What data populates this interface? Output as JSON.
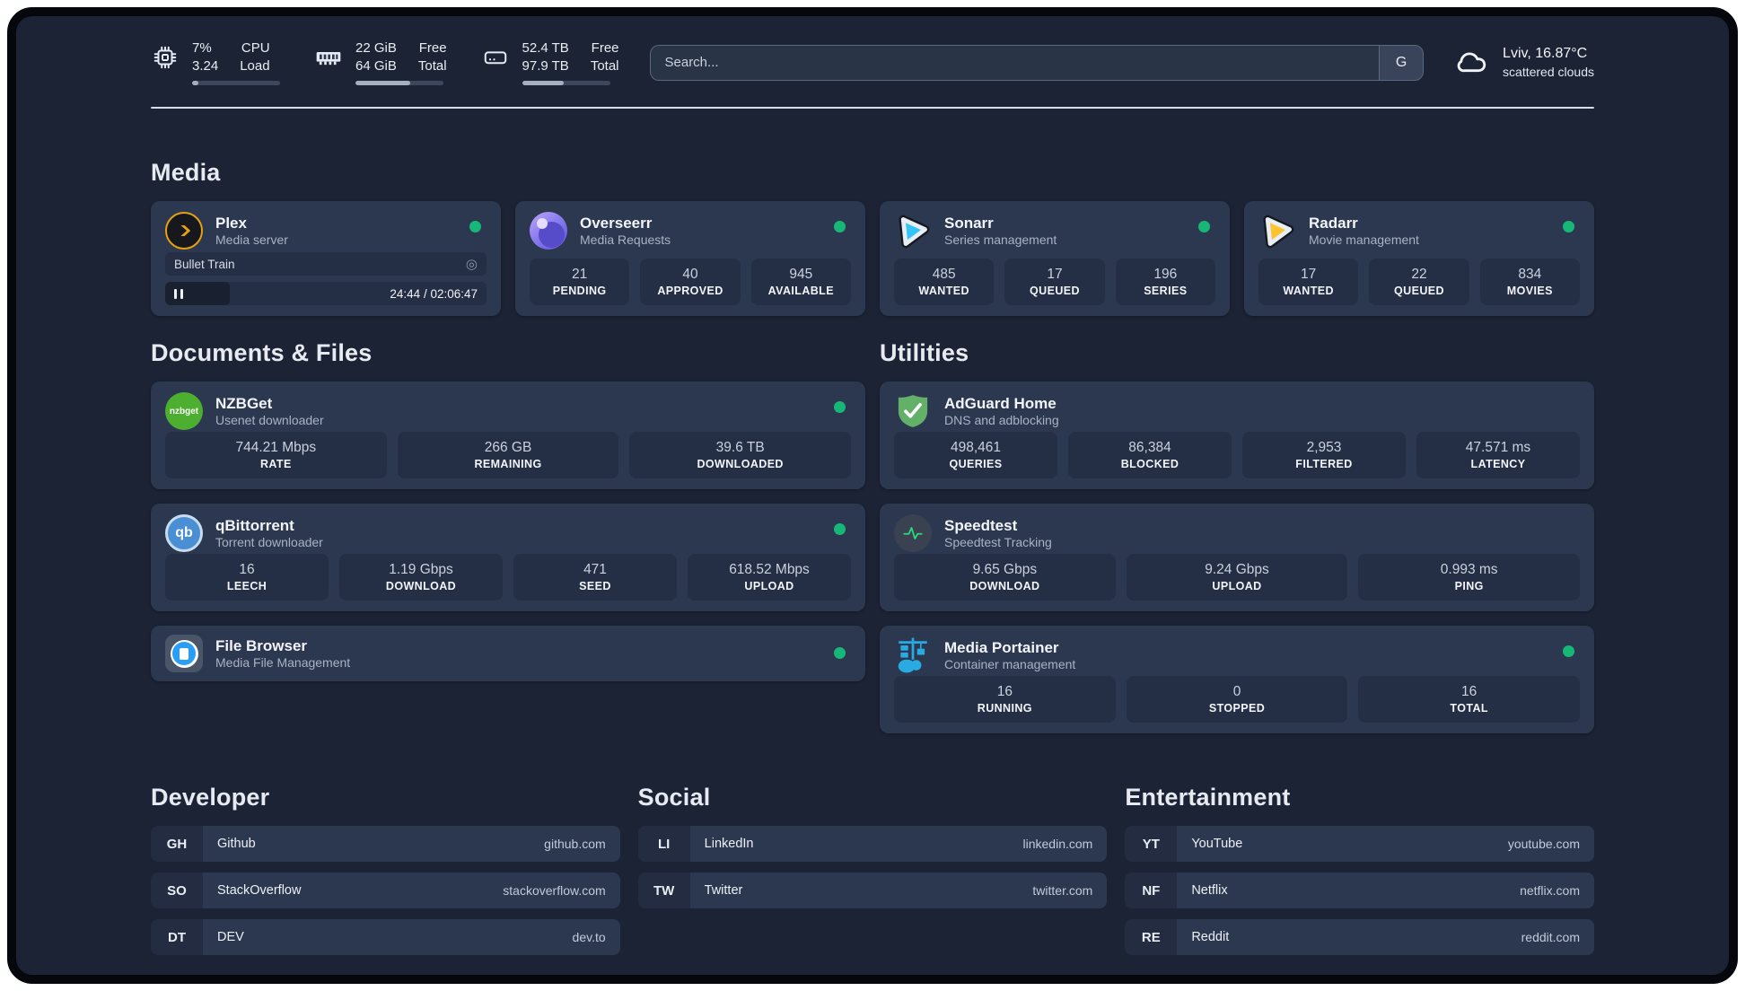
{
  "colors": {
    "page_bg": "#1C2334",
    "card_bg": "#2C3850",
    "tile_bg": "#242E44",
    "status_online": "#17B877",
    "plex_gold": "#E8A10E",
    "sonarr_blue": "#35C5F4",
    "radarr_yellow": "#FFC230",
    "nzbget_green": "#4CAF2F",
    "adguard_green": "#63B168",
    "qbittorrent_blue": "#4A8FD4",
    "speedtest_green": "#2BD97C",
    "portainer_blue": "#29ABE2"
  },
  "header": {
    "system": [
      {
        "icon": "cpu-icon",
        "col1": [
          "7%",
          "3.24"
        ],
        "col2": [
          "CPU",
          "Load"
        ],
        "progress": 7
      },
      {
        "icon": "ram-icon",
        "col1": [
          "22 GiB",
          "64 GiB"
        ],
        "col2": [
          "Free",
          "Total"
        ],
        "progress": 62
      },
      {
        "icon": "disk-icon",
        "col1": [
          "52.4 TB",
          "97.9 TB"
        ],
        "col2": [
          "Free",
          "Total"
        ],
        "progress": 47
      }
    ],
    "search": {
      "placeholder": "Search...",
      "engine_label": "G"
    },
    "weather": {
      "icon": "cloud-icon",
      "location": "Lviv, 16.87°C",
      "condition": "scattered clouds"
    }
  },
  "media": {
    "title": "Media",
    "plex": {
      "name": "Plex",
      "desc": "Media server",
      "status": "online",
      "now_playing": "Bullet Train",
      "time": "24:44 / 02:06:47",
      "progress": 20
    },
    "overseerr": {
      "name": "Overseerr",
      "desc": "Media Requests",
      "status": "online",
      "stats": [
        {
          "value": "21",
          "label": "PENDING"
        },
        {
          "value": "40",
          "label": "APPROVED"
        },
        {
          "value": "945",
          "label": "AVAILABLE"
        }
      ]
    },
    "sonarr": {
      "name": "Sonarr",
      "desc": "Series management",
      "status": "online",
      "stats": [
        {
          "value": "485",
          "label": "WANTED"
        },
        {
          "value": "17",
          "label": "QUEUED"
        },
        {
          "value": "196",
          "label": "SERIES"
        }
      ]
    },
    "radarr": {
      "name": "Radarr",
      "desc": "Movie management",
      "status": "online",
      "stats": [
        {
          "value": "17",
          "label": "WANTED"
        },
        {
          "value": "22",
          "label": "QUEUED"
        },
        {
          "value": "834",
          "label": "MOVIES"
        }
      ]
    }
  },
  "documents": {
    "title": "Documents & Files",
    "nzbget": {
      "name": "NZBGet",
      "desc": "Usenet downloader",
      "status": "online",
      "icon_text": "nzbget",
      "stats": [
        {
          "value": "744.21 Mbps",
          "label": "RATE"
        },
        {
          "value": "266 GB",
          "label": "REMAINING"
        },
        {
          "value": "39.6 TB",
          "label": "DOWNLOADED"
        }
      ]
    },
    "qbittorrent": {
      "name": "qBittorrent",
      "desc": "Torrent downloader",
      "status": "online",
      "icon_text": "qb",
      "stats": [
        {
          "value": "16",
          "label": "LEECH"
        },
        {
          "value": "1.19 Gbps",
          "label": "DOWNLOAD"
        },
        {
          "value": "471",
          "label": "SEED"
        },
        {
          "value": "618.52 Mbps",
          "label": "UPLOAD"
        }
      ]
    },
    "filebrowser": {
      "name": "File Browser",
      "desc": "Media File Management",
      "status": "online"
    }
  },
  "utilities": {
    "title": "Utilities",
    "adguard": {
      "name": "AdGuard Home",
      "desc": "DNS and adblocking",
      "stats": [
        {
          "value": "498,461",
          "label": "QUERIES"
        },
        {
          "value": "86,384",
          "label": "BLOCKED"
        },
        {
          "value": "2,953",
          "label": "FILTERED"
        },
        {
          "value": "47.571 ms",
          "label": "LATENCY"
        }
      ]
    },
    "speedtest": {
      "name": "Speedtest",
      "desc": "Speedtest Tracking",
      "stats": [
        {
          "value": "9.65 Gbps",
          "label": "DOWNLOAD"
        },
        {
          "value": "9.24 Gbps",
          "label": "UPLOAD"
        },
        {
          "value": "0.993 ms",
          "label": "PING"
        }
      ]
    },
    "portainer": {
      "name": "Media Portainer",
      "desc": "Container management",
      "status": "online",
      "stats": [
        {
          "value": "16",
          "label": "RUNNING"
        },
        {
          "value": "0",
          "label": "STOPPED"
        },
        {
          "value": "16",
          "label": "TOTAL"
        }
      ]
    }
  },
  "links": {
    "developer": {
      "title": "Developer",
      "items": [
        {
          "tag": "GH",
          "name": "Github",
          "url": "github.com"
        },
        {
          "tag": "SO",
          "name": "StackOverflow",
          "url": "stackoverflow.com"
        },
        {
          "tag": "DT",
          "name": "DEV",
          "url": "dev.to"
        }
      ]
    },
    "social": {
      "title": "Social",
      "items": [
        {
          "tag": "LI",
          "name": "LinkedIn",
          "url": "linkedin.com"
        },
        {
          "tag": "TW",
          "name": "Twitter",
          "url": "twitter.com"
        }
      ]
    },
    "entertainment": {
      "title": "Entertainment",
      "items": [
        {
          "tag": "YT",
          "name": "YouTube",
          "url": "youtube.com"
        },
        {
          "tag": "NF",
          "name": "Netflix",
          "url": "netflix.com"
        },
        {
          "tag": "RE",
          "name": "Reddit",
          "url": "reddit.com"
        }
      ]
    }
  }
}
